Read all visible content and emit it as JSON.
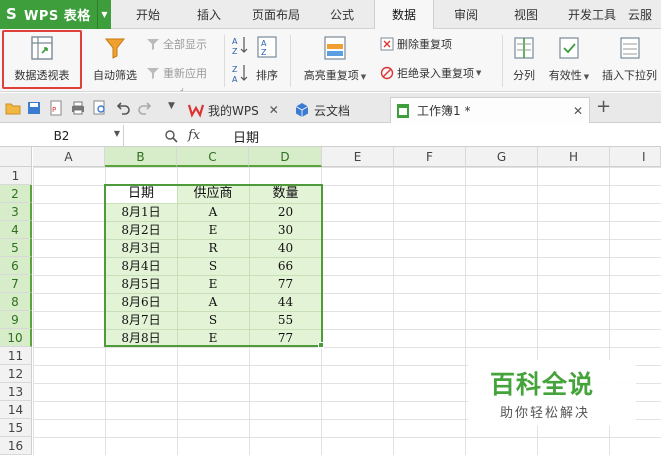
{
  "app": {
    "title": "WPS 表格",
    "logo": "S"
  },
  "menu": {
    "tabs": [
      {
        "label": "开始"
      },
      {
        "label": "插入"
      },
      {
        "label": "页面布局"
      },
      {
        "label": "公式"
      },
      {
        "label": "数据",
        "active": true
      },
      {
        "label": "审阅"
      },
      {
        "label": "视图"
      },
      {
        "label": "开发工具"
      },
      {
        "label": "云服"
      }
    ]
  },
  "ribbon": {
    "pivot": "数据透视表",
    "autofilter": "自动筛选",
    "show_all": "全部显示",
    "reapply": "重新应用",
    "sort": "排序",
    "highlight_dup": "高亮重复项",
    "remove_dup": "删除重复项",
    "reject_dup": "拒绝录入重复项",
    "split": "分列",
    "validity": "有效性",
    "insert_dropdown": "插入下拉列"
  },
  "doc_tabs": {
    "my_wps": "我的WPS",
    "cloud_docs": "云文档",
    "workbook": "工作簿1 *"
  },
  "formula_bar": {
    "cell_ref": "B2",
    "fx": "fx",
    "value": "日期"
  },
  "sheet": {
    "columns": [
      "A",
      "B",
      "C",
      "D",
      "E",
      "F",
      "G",
      "H",
      "I"
    ],
    "rows": [
      "1",
      "2",
      "3",
      "4",
      "5",
      "6",
      "7",
      "8",
      "9",
      "10",
      "11",
      "12",
      "13",
      "14",
      "15",
      "16"
    ],
    "headers": [
      "日期",
      "供应商",
      "数量"
    ],
    "data": [
      [
        "8月1日",
        "A",
        "20"
      ],
      [
        "8月2日",
        "E",
        "30"
      ],
      [
        "8月3日",
        "R",
        "40"
      ],
      [
        "8月4日",
        "S",
        "66"
      ],
      [
        "8月5日",
        "E",
        "77"
      ],
      [
        "8月6日",
        "A",
        "44"
      ],
      [
        "8月7日",
        "S",
        "55"
      ],
      [
        "8月8日",
        "E",
        "77"
      ]
    ]
  },
  "watermark": {
    "main": "百科全说",
    "sub": "助你轻松解决"
  },
  "colors": {
    "brand": "#3d9e3b",
    "selection": "#4f9a3a",
    "highlight": "#e0403a"
  }
}
